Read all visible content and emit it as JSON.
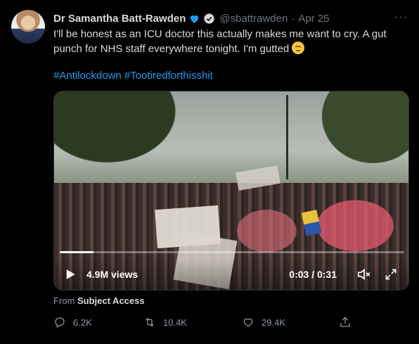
{
  "tweet": {
    "author_name": "Dr Samantha Batt-Rawden",
    "handle": "@sbattrawden",
    "separator": "·",
    "date": "Apr 25",
    "more_label": "···",
    "text": "I'll be honest as an ICU doctor this actually makes me want to cry. A gut punch for NHS staff everywhere tonight. I'm gutted",
    "hashtags": [
      "#Antilockdown",
      "#Tootiredforthisshit"
    ]
  },
  "video": {
    "views": "4.9M views",
    "time": "0:03 / 0:31",
    "progress_fraction": 0.097
  },
  "source": {
    "prefix": "From",
    "name": "Subject Access"
  },
  "actions": {
    "replies": "6.2K",
    "retweets": "10.4K",
    "likes": "29.4K"
  },
  "colors": {
    "background": "#000000",
    "link": "#1d9bf0",
    "muted": "#6e767d",
    "heart": "#1d9bf0"
  }
}
